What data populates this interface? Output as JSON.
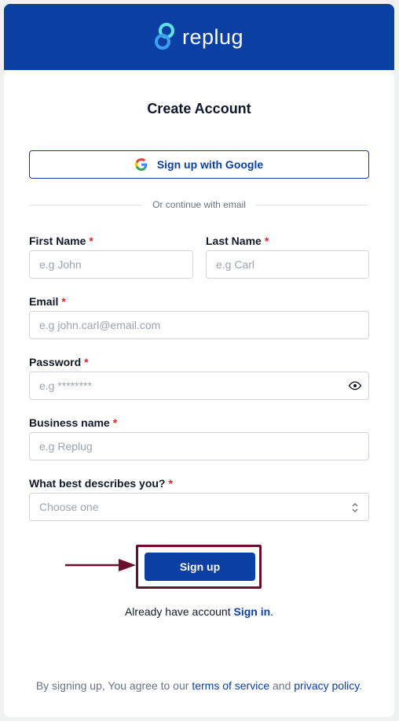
{
  "brand": {
    "name": "replug",
    "header_color": "#0b3fa1"
  },
  "title": "Create Account",
  "google": {
    "label": "Sign up with Google",
    "icon": "google-icon"
  },
  "divider_text": "Or continue with email",
  "required_mark": "*",
  "fields": {
    "first_name": {
      "label": "First Name",
      "placeholder": "e.g John"
    },
    "last_name": {
      "label": "Last Name",
      "placeholder": "e.g Carl"
    },
    "email": {
      "label": "Email",
      "placeholder": "e.g john.carl@email.com"
    },
    "password": {
      "label": "Password",
      "placeholder": "e.g ********",
      "icon": "eye-icon"
    },
    "business": {
      "label": "Business name",
      "placeholder": "e.g Replug"
    },
    "describe": {
      "label": "What best describes you?",
      "selected": "Choose one"
    }
  },
  "signup_label": "Sign up",
  "signin": {
    "prefix": "Already have account ",
    "link": "Sign in",
    "suffix": "."
  },
  "terms": {
    "prefix": "By signing up, You agree to our ",
    "tos": "terms of service",
    "and": " and ",
    "privacy": "privacy policy",
    "suffix": "."
  },
  "colors": {
    "accent": "#0b3fa1",
    "required": "#dc2626",
    "annotation": "#6b0f2f"
  }
}
